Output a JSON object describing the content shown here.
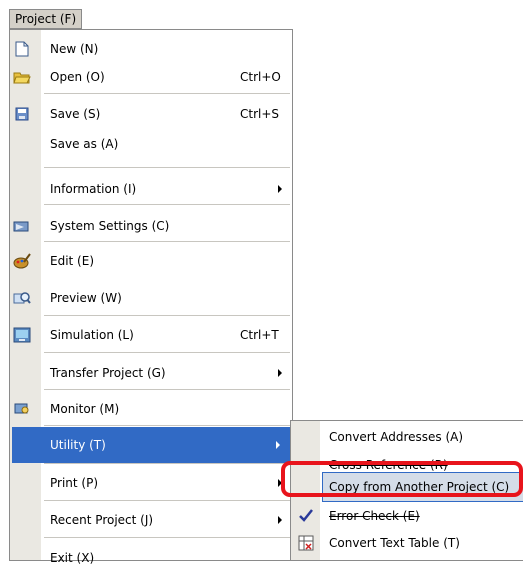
{
  "menubar": {
    "project_label": "Project (F)"
  },
  "menu": {
    "items": [
      {
        "label": "New (N)",
        "shortcut": "",
        "icon": "new-file-icon"
      },
      {
        "label": "Open (O)",
        "shortcut": "Ctrl+O",
        "icon": "open-folder-icon"
      },
      {
        "label": "Save (S)",
        "shortcut": "Ctrl+S",
        "icon": "save-disk-icon"
      },
      {
        "label": "Save as (A)",
        "shortcut": ""
      },
      {
        "label": "Information (I)",
        "shortcut": "",
        "submenu": true
      },
      {
        "label": "System Settings (C)",
        "shortcut": "",
        "icon": "system-settings-icon"
      },
      {
        "label": "Edit (E)",
        "shortcut": "",
        "icon": "edit-palette-icon"
      },
      {
        "label": "Preview (W)",
        "shortcut": "",
        "icon": "preview-magnifier-icon"
      },
      {
        "label": "Simulation  (L)",
        "shortcut": "Ctrl+T",
        "icon": "simulation-icon"
      },
      {
        "label": "Transfer Project (G)",
        "shortcut": "",
        "submenu": true
      },
      {
        "label": "Monitor (M)",
        "shortcut": "",
        "icon": "monitor-icon"
      },
      {
        "label": "Utility (T)",
        "shortcut": "",
        "submenu": true,
        "highlighted": true
      },
      {
        "label": "Print (P)",
        "shortcut": "",
        "submenu": true
      },
      {
        "label": "Recent Project (J)",
        "shortcut": "",
        "submenu": true
      },
      {
        "label": "Exit (X)",
        "shortcut": ""
      }
    ]
  },
  "submenu": {
    "items": [
      {
        "label": "Convert Addresses (A)"
      },
      {
        "label": "Cross Reference (R)"
      },
      {
        "label": "Copy from Another Project (C)",
        "highlighted": true
      },
      {
        "label": "Error Check (E)",
        "icon": "checkmark-icon"
      },
      {
        "label": "Convert Text Table (T)",
        "icon": "text-table-icon"
      }
    ]
  },
  "colors": {
    "highlight": "#316ac5",
    "annotation_red": "#e8141c",
    "gutter": "#eae8e2"
  }
}
